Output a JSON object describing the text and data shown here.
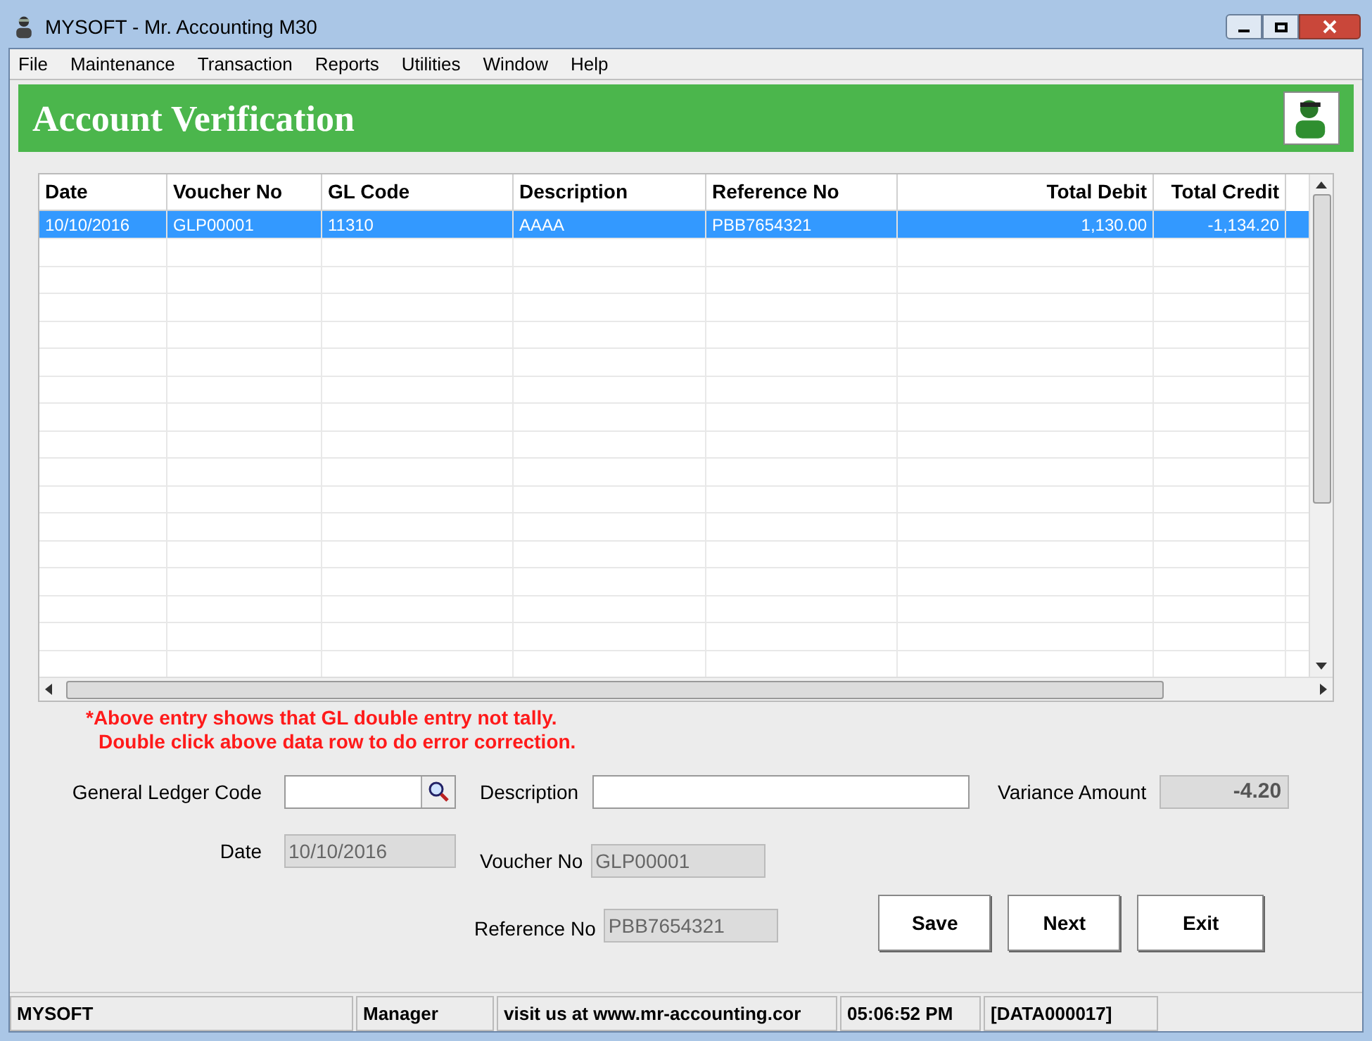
{
  "window": {
    "title": "MYSOFT - Mr. Accounting M30"
  },
  "menu": [
    "File",
    "Maintenance",
    "Transaction",
    "Reports",
    "Utilities",
    "Window",
    "Help"
  ],
  "banner": {
    "title": "Account Verification"
  },
  "table": {
    "columns": [
      {
        "label": "Date",
        "kind": "text"
      },
      {
        "label": "Voucher No",
        "kind": "text"
      },
      {
        "label": "GL Code",
        "kind": "text"
      },
      {
        "label": "Description",
        "kind": "text"
      },
      {
        "label": "Reference No",
        "kind": "text"
      },
      {
        "label": "Total Debit",
        "kind": "amount"
      },
      {
        "label": "Total Credit",
        "kind": "amount"
      }
    ],
    "rows": [
      {
        "selected": true,
        "cells": [
          "10/10/2016",
          "GLP00001",
          "11310",
          "AAAA",
          "PBB7654321",
          "1,130.00",
          "-1,134.20"
        ]
      }
    ]
  },
  "warning": [
    "*Above entry shows that GL double entry not tally.",
    "Double click above data row to do error correction."
  ],
  "form": {
    "gl_code": {
      "label": "General Ledger Code"
    },
    "description": {
      "label": "Description"
    },
    "variance": {
      "label": "Variance Amount",
      "value": "-4.20"
    },
    "date": {
      "label": "Date",
      "value": "10/10/2016"
    },
    "voucher": {
      "label": "Voucher No",
      "value": "GLP00001"
    },
    "reference": {
      "label": "Reference No",
      "value": "PBB7654321"
    }
  },
  "buttons": [
    "Save",
    "Next",
    "Exit"
  ],
  "status_bar": [
    "MYSOFT",
    "Manager",
    "visit us at www.mr-accounting.cor",
    "05:06:52 PM",
    "[DATA000017]"
  ]
}
